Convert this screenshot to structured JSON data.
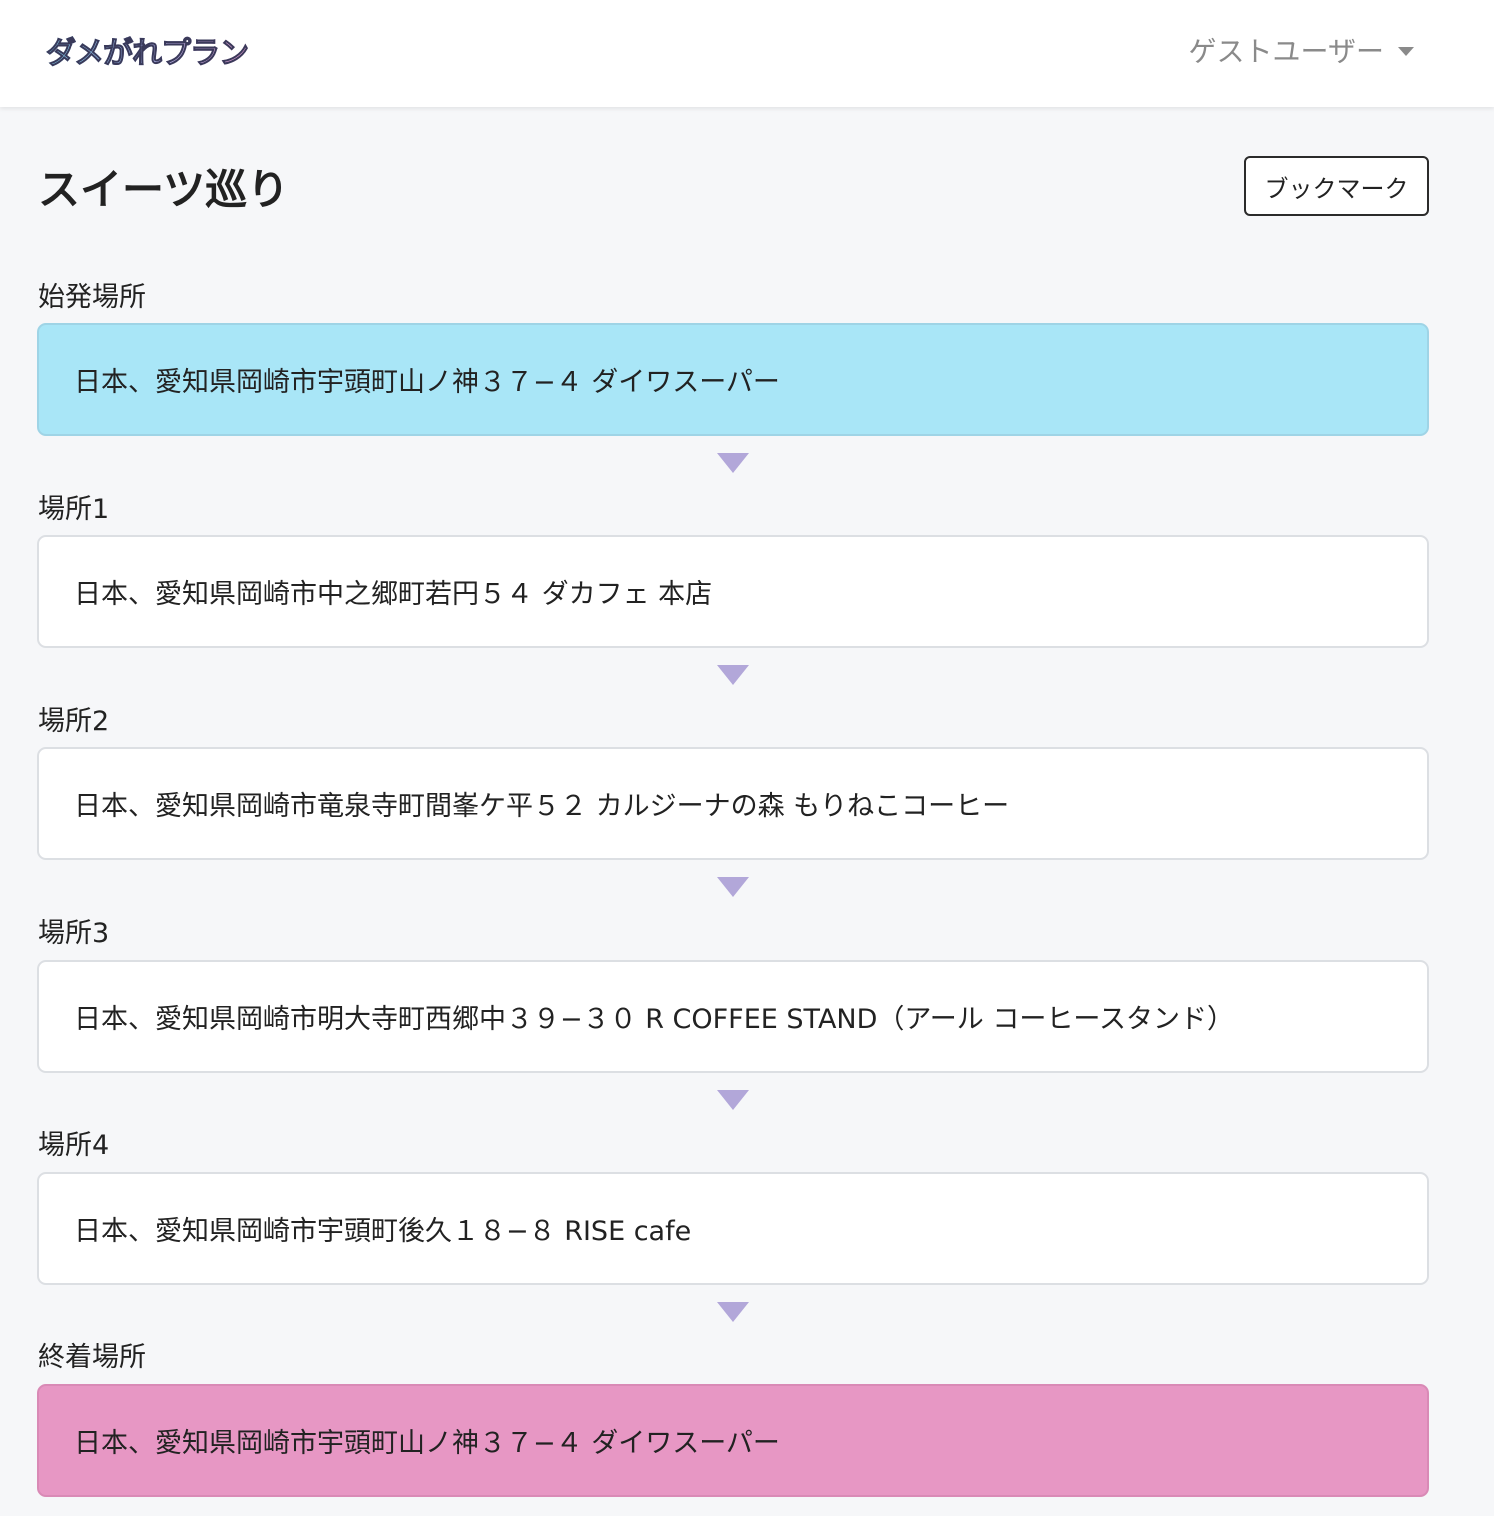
{
  "navbar": {
    "logo_text": "ダメがれプラン",
    "user_label": "ゲストユーザー",
    "user_menu_icon": "chevron-down-icon"
  },
  "page": {
    "title": "スイーツ巡り",
    "bookmark_label": "ブックマーク"
  },
  "stops": [
    {
      "label": "始発場所",
      "address": "日本、愛知県岡崎市宇頭町山ノ神３７−４ ダイワスーパー"
    },
    {
      "label": "場所1",
      "address": "日本、愛知県岡崎市中之郷町若円５４ ダカフェ 本店"
    },
    {
      "label": "場所2",
      "address": "日本、愛知県岡崎市竜泉寺町間峯ケ平５２ カルジーナの森 もりねこコーヒー"
    },
    {
      "label": "場所3",
      "address": "日本、愛知県岡崎市明大寺町西郷中３９−３０ R COFFEE STAND（アール コーヒースタンド）"
    },
    {
      "label": "場所4",
      "address": "日本、愛知県岡崎市宇頭町後久１８−８ RISE cafe"
    },
    {
      "label": "終着場所",
      "address": "日本、愛知県岡崎市宇頭町山ノ神３７−４ ダイワスーパー"
    }
  ],
  "colors": {
    "start": "#a9e6f7",
    "end": "#e797c4",
    "arrow": "#b2a7d9"
  }
}
